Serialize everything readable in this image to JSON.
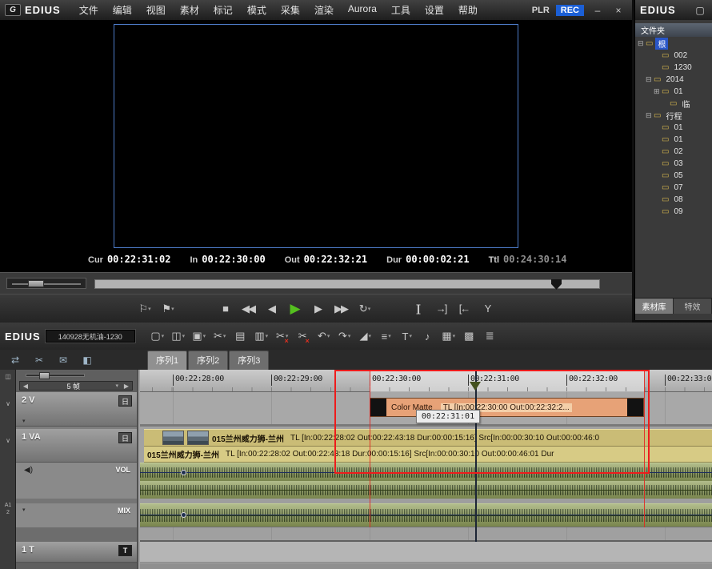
{
  "colors": {
    "accent_blue": "#2a57c8",
    "rec_blue": "#1b5fd6",
    "selection_red": "#ee1c1c",
    "play_green": "#55c01f",
    "matte_clip": "#e7a277",
    "video_clip": "#cabc76",
    "audio_wave": "#93a25e"
  },
  "menubar": {
    "logo_badge": "G",
    "logo_text": "EDIUS",
    "menus": [
      "文件",
      "编辑",
      "视图",
      "素材",
      "标记",
      "模式",
      "采集",
      "渲染",
      "Aurora",
      "工具",
      "设置",
      "帮助"
    ],
    "plr_label": "PLR",
    "rec_label": "REC",
    "minimize_glyph": "–",
    "close_glyph": "×"
  },
  "monitor": {
    "timecodes": [
      {
        "label": "Cur",
        "value": "00:22:31:02"
      },
      {
        "label": "In",
        "value": "00:22:30:00"
      },
      {
        "label": "Out",
        "value": "00:22:32:21"
      },
      {
        "label": "Dur",
        "value": "00:00:02:21"
      },
      {
        "label": "Ttl",
        "value": "00:24:30:14",
        "state": "dim"
      }
    ],
    "transport_marks": [
      {
        "name": "set-in-icon",
        "glyph": "⚐",
        "dd": "▾"
      },
      {
        "name": "set-out-icon",
        "glyph": "⚑",
        "dd": "▾"
      }
    ],
    "transport_main": [
      {
        "name": "stop-icon",
        "glyph": "■"
      },
      {
        "name": "rewind-icon",
        "glyph": "◀◀"
      },
      {
        "name": "prev-frame-icon",
        "glyph": "◀"
      },
      {
        "name": "play-icon",
        "glyph": "▶",
        "state": "play"
      },
      {
        "name": "next-frame-icon",
        "glyph": "▶"
      },
      {
        "name": "fast-forward-icon",
        "glyph": "▶▶"
      },
      {
        "name": "loop-icon",
        "glyph": "↻",
        "dd": "▾"
      }
    ],
    "transport_edit": [
      {
        "name": "set-in-here-icon",
        "glyph": "]["
      },
      {
        "name": "extend-in-icon",
        "glyph": "→]"
      },
      {
        "name": "extend-out-icon",
        "glyph": "[←"
      },
      {
        "name": "match-frame-icon",
        "glyph": "Y"
      }
    ]
  },
  "bin": {
    "window_title": "EDIUS",
    "restore_glyph": "▢",
    "folder_header": "文件夹",
    "folder_glyph": "▭",
    "tree": [
      {
        "label": "根",
        "d": "d0",
        "expander": "⊟",
        "state": "selected"
      },
      {
        "label": "002",
        "d": "d2"
      },
      {
        "label": "1230",
        "d": "d2"
      },
      {
        "label": "2014",
        "d": "d1",
        "expander": "⊟"
      },
      {
        "label": "01",
        "d": "d2",
        "expander": "⊞"
      },
      {
        "label": "临",
        "d": "d3"
      },
      {
        "label": "行程",
        "d": "d1",
        "expander": "⊟"
      },
      {
        "label": "01",
        "d": "d2"
      },
      {
        "label": "01",
        "d": "d2"
      },
      {
        "label": "02",
        "d": "d2"
      },
      {
        "label": "03",
        "d": "d2"
      },
      {
        "label": "05",
        "d": "d2"
      },
      {
        "label": "07",
        "d": "d2"
      },
      {
        "label": "08",
        "d": "d2"
      },
      {
        "label": "09",
        "d": "d2"
      }
    ],
    "tabs": [
      {
        "label": "素材库",
        "state": "active"
      },
      {
        "label": "特效"
      }
    ]
  },
  "timeline": {
    "logo_text": "EDIUS",
    "project_title": "140928无机油-1230",
    "toolbar": [
      {
        "name": "new-sequence-icon",
        "glyph": "▢",
        "dd": "▾"
      },
      {
        "name": "open-project-icon",
        "glyph": "◫",
        "dd": "▾"
      },
      {
        "name": "save-project-icon",
        "glyph": "▣",
        "dd": "▾"
      },
      {
        "name": "cut-icon",
        "glyph": "✂",
        "dd": "▾"
      },
      {
        "name": "copy-icon",
        "glyph": "▤"
      },
      {
        "name": "paste-icon",
        "glyph": "▥",
        "dd": "▾"
      },
      {
        "name": "ripple-cut-icon",
        "glyph": "✂",
        "badge": "×",
        "dd": "▾"
      },
      {
        "name": "delete-icon",
        "glyph": "✂",
        "badge": "×"
      },
      {
        "name": "undo-icon",
        "glyph": "↶",
        "dd": "▾"
      },
      {
        "name": "redo-icon",
        "glyph": "↷",
        "dd": "▾"
      },
      {
        "name": "fade-icon",
        "glyph": "◢",
        "dd": "▾"
      },
      {
        "name": "transition-icon",
        "glyph": "≡",
        "dd": "▾"
      },
      {
        "name": "title-icon",
        "glyph": "T",
        "dd": "▾"
      },
      {
        "name": "voiceover-icon",
        "glyph": "♪"
      },
      {
        "name": "export-icon",
        "glyph": "▦",
        "dd": "▾"
      },
      {
        "name": "capture-icon",
        "glyph": "▩"
      },
      {
        "name": "mixer-icon",
        "glyph": "≣"
      }
    ],
    "mode_icons": [
      {
        "name": "sync-mode-icon",
        "glyph": "⇄"
      },
      {
        "name": "ripple-mode-icon",
        "glyph": "✂"
      },
      {
        "name": "mail-export-icon",
        "glyph": "✉"
      },
      {
        "name": "monitor-mode-icon",
        "glyph": "◧"
      }
    ],
    "sequence_tabs": [
      {
        "label": "序列1",
        "state": "active"
      },
      {
        "label": "序列2"
      },
      {
        "label": "序列3"
      }
    ],
    "ruler_marks": [
      "00:22:28:00",
      "00:22:29:00",
      "00:22:30:00",
      "00:22:31:00",
      "00:22:32:00",
      "00:22:33:00"
    ],
    "tracks": {
      "zoom_value": "5 帧",
      "zoom_left_arrow": "◀",
      "zoom_right_arrow": "▶",
      "zoom_dd": "▾",
      "v_label": "2 V",
      "va_label": "1 VA",
      "t_label": "1 T",
      "vol_label": "VOL",
      "mix_label": "MIX",
      "mask_glyph": "日",
      "title_glyph": "T",
      "speaker_glyph": "◀)",
      "patch_top": "◫",
      "patch_v": "∨",
      "patch_va": "∨",
      "patch_a1": "A1",
      "patch_2": "2"
    },
    "clips": {
      "matte_name": "Color Matte",
      "matte_info": "TL [In:00:22:30:00 Out:00:22:32:2...",
      "video_name": "015兰州威力狮-兰州",
      "video_info_upper": "TL [In:00:22:28:02 Out:00:22:43:18 Dur:00:00:15:16]  Src[In:00:00:30:10 Out:00:00:46:0",
      "video_info_lower": "TL [In:00:22:28:02 Out:00:22:43:18 Dur:00:00:15:16]  Src[In:00:00:30:10 Out:00:00:46:01 Dur",
      "tooltip": "00:22:31:01"
    }
  }
}
